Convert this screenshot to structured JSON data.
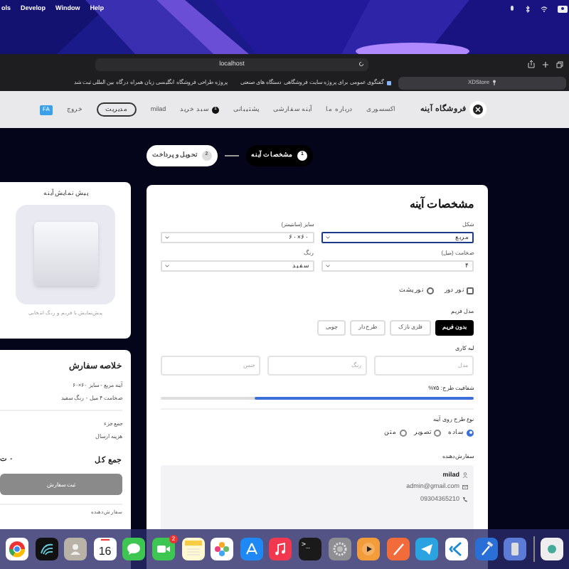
{
  "menu_bar": {
    "cut_item": "ols",
    "develop_menu": "Develop",
    "window_menu": "Window",
    "help_menu": "Help"
  },
  "browser": {
    "address": "localhost",
    "tabs": [
      {
        "title": "XDStore",
        "selected": true
      },
      {
        "title": "گفتگوی عمومی برای پروژه سایت فروشگاهی دستگاه های صنعتی",
        "selected": false
      },
      {
        "title": "پروژه طراحی فروشگاه انگلیسی زبان همراه درگاه بین المللی ثبت شد",
        "selected": false
      }
    ]
  },
  "site_nav": {
    "brand": "فروشگاه آینه",
    "links": [
      "اکسسوری",
      "درباره ما",
      "آینه سفارشی",
      "پشتیبانی"
    ],
    "cart": {
      "label": "سبد خرید",
      "count": "1"
    },
    "user": "milad",
    "admin_button": "مدیریت",
    "logout": "خروج",
    "language": "FA"
  },
  "stepper": [
    {
      "number": "1",
      "label": "مشخصات آینه",
      "selected": true
    },
    {
      "number": "2",
      "label": "تحویل و پرداخت",
      "selected": false
    }
  ],
  "form": {
    "title": "مشخصات آینه",
    "fields": [
      {
        "label": "شکل",
        "value": "مربع",
        "focused": true
      },
      {
        "label": "سایز (سانتیمتر)",
        "value": "۶۰×۶۰",
        "focused": false
      },
      {
        "label": "ضخامت (میل)",
        "value": "۴",
        "focused": false
      },
      {
        "label": "رنگ",
        "value": "سفید",
        "focused": false
      }
    ],
    "lights": [
      {
        "label": "نور دور",
        "checked": false
      },
      {
        "label": "نور پشت",
        "checked": false
      }
    ],
    "frame": {
      "label": "مدل فریم",
      "options": [
        {
          "label": "بدون فریم",
          "selected": true
        },
        {
          "label": "فلزی نازک",
          "selected": false
        },
        {
          "label": "طرح‌دار",
          "selected": false
        },
        {
          "label": "چوبی",
          "selected": false
        }
      ]
    },
    "edge": {
      "label": "لبه کاری",
      "placeholders": [
        "مدل",
        "رنگ",
        "جنس"
      ]
    },
    "opacity": {
      "label": "شفافیت طرح: ۷۵%",
      "level": 0.7
    },
    "design_type": {
      "label": "نوع طرح روی آینه",
      "options": [
        {
          "label": "ساده",
          "selected": true
        },
        {
          "label": "تصویر",
          "selected": false
        },
        {
          "label": "متن",
          "selected": false
        }
      ]
    },
    "customer": {
      "label": "سفارش‌دهنده",
      "name": "milad",
      "email": "admin@gmail.com",
      "phone": "09304365210"
    }
  },
  "preview": {
    "title": "پیش نمایش آینه",
    "caption": "پیش‌نمایش با فریم و رنگ انتخابی"
  },
  "summary": {
    "title": "خلاصه سفارش",
    "lines": [
      "آینه مربع - سایز ۶۰×۶۰",
      "ضخامت ۴ میل - رنگ سفید"
    ],
    "subtotal_label": "جمع جزء",
    "shipping_label": "هزینه ارسال",
    "total_label": "جمع کل",
    "total_value": "۰ ت",
    "submit_button": "ثبت سفارش",
    "customer_label": "سفارش‌دهنده"
  },
  "dock": {
    "calendar_day": "16",
    "video_badge": "2",
    "terminal_text": ">_"
  }
}
